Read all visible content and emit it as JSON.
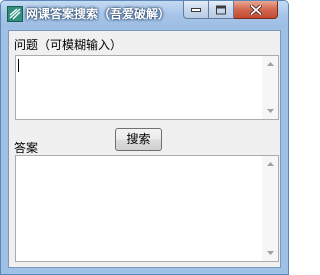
{
  "window": {
    "title": "网课答案搜索（吾爱破解）",
    "icon": "app-icon"
  },
  "question": {
    "label": "问题（可模糊输入）",
    "value": ""
  },
  "search": {
    "label": "搜索"
  },
  "answer": {
    "label": "答案",
    "value": ""
  },
  "colors": {
    "titlebar": "#a7c5e8",
    "close_button": "#c44a31",
    "client_bg": "#f0f0f0"
  }
}
